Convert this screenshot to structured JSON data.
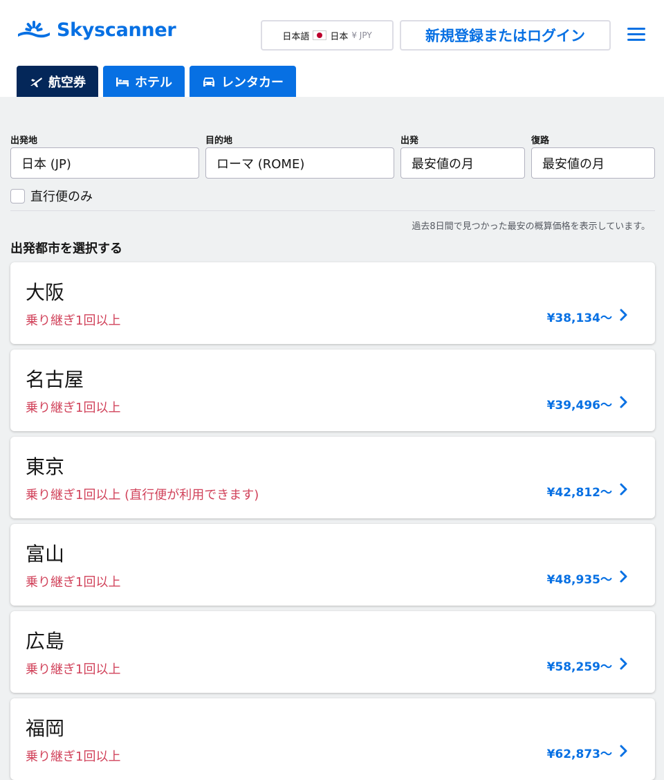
{
  "header": {
    "logo_text": "Skyscanner",
    "locale_lang": "日本語",
    "locale_country": "日本",
    "locale_currency": "¥ JPY",
    "login_label": "新規登録またはログイン",
    "menu_icon": "hamburger-menu-icon",
    "tabs": [
      {
        "label": "航空券",
        "icon": "plane-icon",
        "active": true
      },
      {
        "label": "ホテル",
        "icon": "bed-icon",
        "active": false
      },
      {
        "label": "レンタカー",
        "icon": "car-icon",
        "active": false
      }
    ]
  },
  "search": {
    "origin_label": "出発地",
    "origin_value": "日本 (JP)",
    "destination_label": "目的地",
    "destination_value": "ローマ (ROME)",
    "depart_label": "出発",
    "depart_value": "最安値の月",
    "return_label": "復路",
    "return_value": "最安値の月",
    "direct_only_label": "直行便のみ",
    "direct_only_checked": false
  },
  "results": {
    "note": "過去8日間で見つかった最安の概算価格を表示しています。",
    "section_title": "出発都市を選択する",
    "items": [
      {
        "city": "大阪",
        "transfer": "乗り継ぎ1回以上",
        "price": "¥38,134〜"
      },
      {
        "city": "名古屋",
        "transfer": "乗り継ぎ1回以上",
        "price": "¥39,496〜"
      },
      {
        "city": "東京",
        "transfer": "乗り継ぎ1回以上 (直行便が利用できます)",
        "price": "¥42,812〜"
      },
      {
        "city": "富山",
        "transfer": "乗り継ぎ1回以上",
        "price": "¥48,935〜"
      },
      {
        "city": "広島",
        "transfer": "乗り継ぎ1回以上",
        "price": "¥58,259〜"
      },
      {
        "city": "福岡",
        "transfer": "乗り継ぎ1回以上",
        "price": "¥62,873〜"
      }
    ]
  },
  "colors": {
    "brand_blue": "#0770e3",
    "active_tab": "#042759",
    "transfer_red": "#d1435b",
    "background": "#eff1f2"
  }
}
